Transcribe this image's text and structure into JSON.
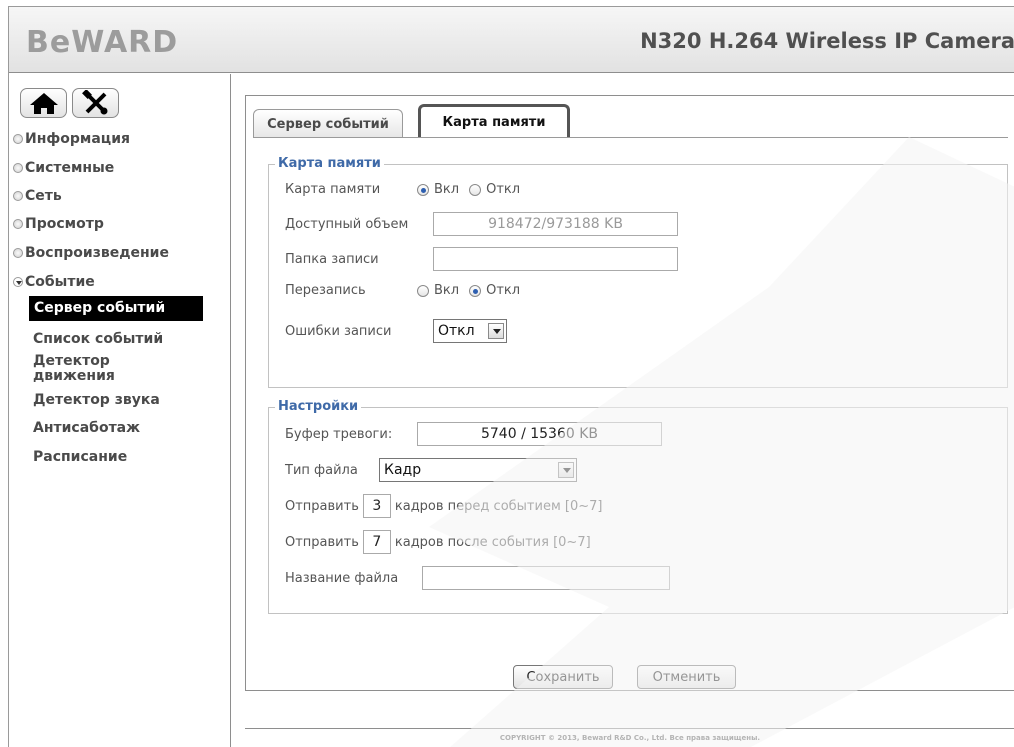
{
  "header": {
    "logo": "BeWARD",
    "product_title": "N320 H.264 Wireless IP Camera"
  },
  "sidebar": {
    "buttons": [
      {
        "name": "home",
        "icon": "home-icon"
      },
      {
        "name": "tools",
        "icon": "tools-icon"
      }
    ],
    "items": [
      {
        "label": "Информация"
      },
      {
        "label": "Системные"
      },
      {
        "label": "Сеть"
      },
      {
        "label": "Просмотр"
      },
      {
        "label": "Воспроизведение"
      },
      {
        "label": "Событие",
        "open": true
      }
    ],
    "subitems": [
      {
        "label": "Сервер событий",
        "active": true
      },
      {
        "label": "Список событий"
      },
      {
        "label": "Детектор движения"
      },
      {
        "label": "Детектор звука"
      },
      {
        "label": "Антисаботаж"
      },
      {
        "label": "Расписание"
      }
    ]
  },
  "tabs": [
    {
      "label": "Сервер событий",
      "selected": false
    },
    {
      "label": "Карта памяти",
      "selected": true
    }
  ],
  "memory_card": {
    "legend": "Карта памяти",
    "card_label": "Карта памяти",
    "card_on": "Вкл",
    "card_off": "Откл",
    "card_value": "Вкл",
    "capacity_label": "Доступный объем",
    "capacity_value": "918472/973188 KB",
    "folder_label": "Папка записи",
    "folder_value": "",
    "overwrite_label": "Перезапись",
    "overwrite_on": "Вкл",
    "overwrite_off": "Откл",
    "overwrite_value": "Откл",
    "errors_label": "Ошибки записи",
    "errors_value": "Откл"
  },
  "settings": {
    "legend": "Настройки",
    "alarm_buffer_label": "Буфер тревоги:",
    "alarm_buffer_value": "5740 / 15360 KB",
    "file_type_label": "Тип файла",
    "file_type_value": "Кадр",
    "send_before_prefix": "Отправить",
    "send_before_value": "3",
    "send_before_suffix": "кадров перед событием [0~7]",
    "send_after_prefix": "Отправить",
    "send_after_value": "7",
    "send_after_suffix": "кадров после события [0~7]",
    "filename_label": "Название файла",
    "filename_value": ""
  },
  "actions": {
    "save": "Сохранить",
    "cancel": "Отменить"
  },
  "footer": {
    "copyright": "COPYRIGHT © 2013, Beward R&D Co., Ltd. Все права защищены."
  },
  "colors": {
    "legend": "#3f6aa8",
    "radio_selected": "#2e5fb0",
    "active_menu_bg": "#000000"
  }
}
